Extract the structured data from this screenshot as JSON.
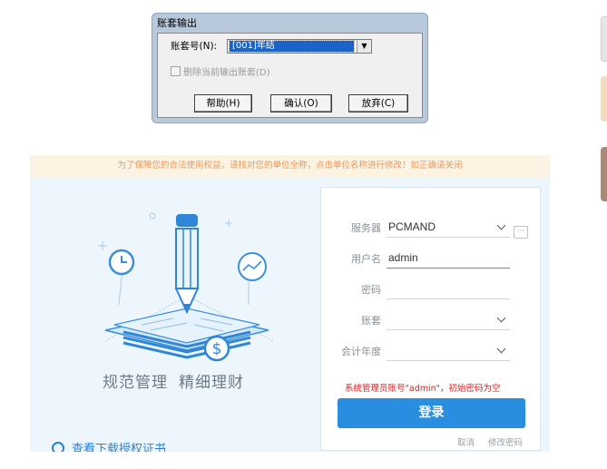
{
  "dialog": {
    "title": "账套输出",
    "account_label": "账套号(N):",
    "account_value": "[001]年结",
    "delete_label": "删除当前输出账套(D)",
    "help_button": "帮助(H)",
    "ok_button": "确认(O)",
    "cancel_button": "放弃(C)"
  },
  "login": {
    "notice": "为了保障您的合法使用权益，请核对您的单位全称，点击单位名称进行修改！如正确请关闭",
    "slogan_1": "规范管理",
    "slogan_2": "精细理财",
    "footer_link": "查看下载授权证书",
    "server_label": "服务器",
    "server_value": "PCMAND",
    "more_icon": "···",
    "user_label": "用户名",
    "user_value": "admin",
    "password_label": "密码",
    "password_value": "",
    "account_label": "账套",
    "account_value": "",
    "year_label": "会计年度",
    "year_value": "",
    "warning": "系统管理员账号\"admin\"，初始密码为空",
    "login_button": "登录",
    "cancel_link": "取消",
    "change_password_link": "修改密码"
  },
  "colors": {
    "primary": "#2a8ee0",
    "notice_text": "#e89a5c",
    "warning": "#d8242a",
    "panel_bg": "#eef6fd"
  }
}
